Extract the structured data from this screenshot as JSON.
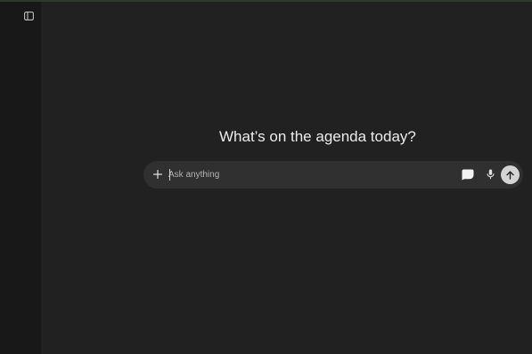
{
  "sidebar": {
    "toggle_icon": "sidebar-toggle-icon"
  },
  "main": {
    "headline": "What’s on the agenda today?"
  },
  "composer": {
    "placeholder": "Ask anything",
    "value": "",
    "icons": {
      "add": "plus-icon",
      "voice_chat": "speech-bubble-icon",
      "dictate": "microphone-icon",
      "send": "arrow-up-icon"
    }
  },
  "colors": {
    "background": "#212121",
    "sidebar": "#181818",
    "composer": "#303030",
    "send_button": "#d4d4d4",
    "text": "#ececec"
  }
}
